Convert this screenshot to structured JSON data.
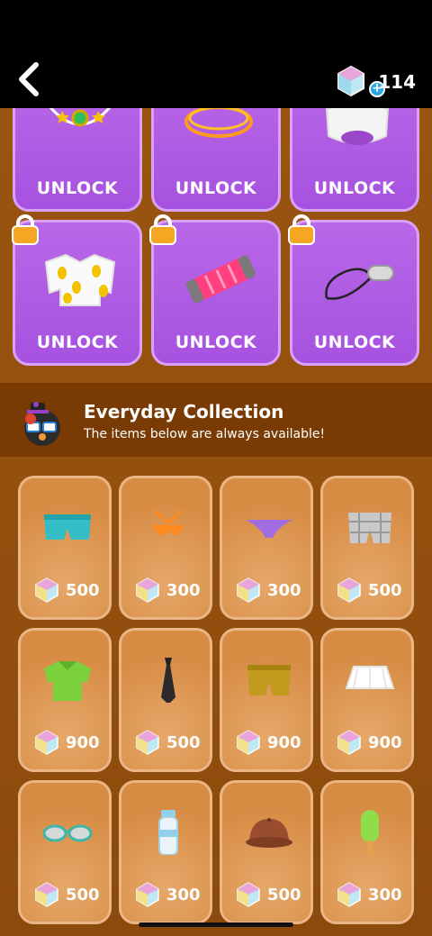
{
  "header": {
    "gem_count": "114"
  },
  "locked": {
    "unlock_label": "UNLOCK"
  },
  "banner": {
    "title": "Everyday Collection",
    "subtitle": "The items below are always available!"
  },
  "shop_items": [
    {
      "name": "teal-shorts",
      "price": "500"
    },
    {
      "name": "orange-bikini-top",
      "price": "300"
    },
    {
      "name": "purple-bikini-bottom",
      "price": "300"
    },
    {
      "name": "plaid-shorts",
      "price": "500"
    },
    {
      "name": "green-polo-shirt",
      "price": "900"
    },
    {
      "name": "black-necktie",
      "price": "500"
    },
    {
      "name": "khaki-shorts",
      "price": "900"
    },
    {
      "name": "white-skirt",
      "price": "900"
    },
    {
      "name": "teal-glasses",
      "price": "500"
    },
    {
      "name": "water-bottle",
      "price": "300"
    },
    {
      "name": "brown-cap",
      "price": "500"
    },
    {
      "name": "green-popsicle",
      "price": "300"
    }
  ]
}
